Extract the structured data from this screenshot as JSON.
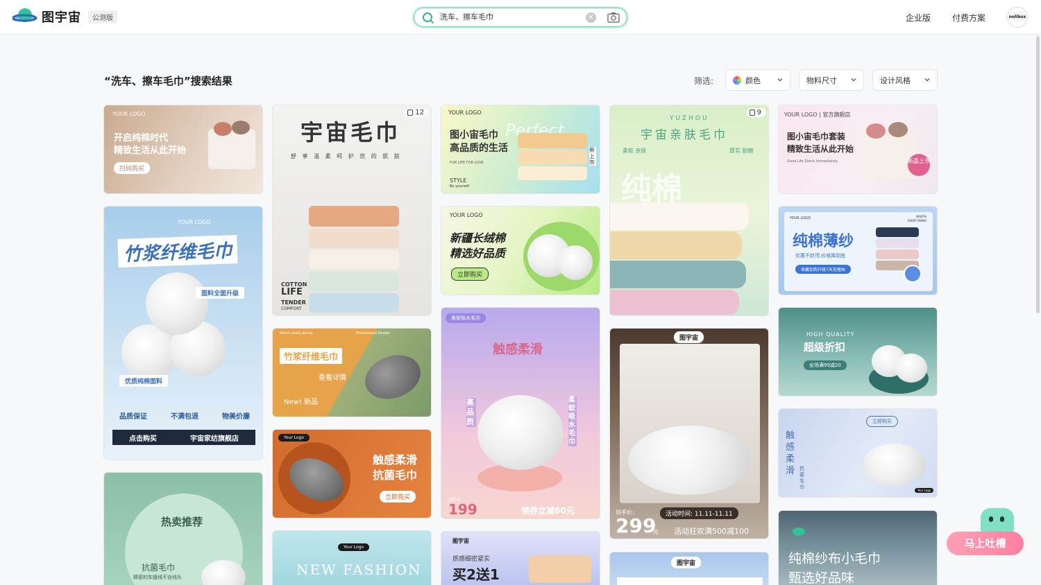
{
  "header": {
    "logo_text": "图宇宙",
    "beta_tag": "公测版",
    "search_value": "洗车、擦车毛巾",
    "clear_symbol": "✕",
    "nav_enterprise": "企业版",
    "nav_pricing": "付费方案",
    "avatar_text": "nolibox"
  },
  "results": {
    "title": "“洗车、擦车毛巾”搜索结果",
    "filter_label": "筛选:",
    "filters": [
      "颜色",
      "物料尺寸",
      "设计风格"
    ]
  },
  "cards": {
    "c1": {
      "line1": "开启纯棉时代",
      "line2": "精致生活从此开始",
      "button": "扫码购买",
      "logo": "YOUR LOGO"
    },
    "c2": {
      "title": "宇宙毛巾",
      "sub": "舒 享 温 柔 呵 护 您 的 肌 肤",
      "count": "12",
      "eng1": "COTTON",
      "eng2": "LIFE",
      "eng3": "TENDER",
      "eng4": "COMFORT"
    },
    "c3": {
      "line1": "图小宙毛巾",
      "line2": "高品质的生活",
      "bg_word": "Perfect",
      "small": "FOR LIFE FOR LOVE",
      "style": "STYLE",
      "style_sub": "Be yourself",
      "logo": "YOUR LOGO",
      "side": "新上市"
    },
    "c4": {
      "top": "YUZHOU",
      "title": "宇宙亲肤毛巾",
      "left": "柔软 亲肤",
      "right": "厚实 耐磨",
      "bg": "纯棉",
      "count": "9"
    },
    "c5": {
      "line1": "图小宙毛巾套装",
      "line2": "精致生活从此开始",
      "small": "Good Life Starts Immediately",
      "stamp": "新品上市",
      "logo": "YOUR LOGO | 官方旗舰店"
    },
    "c6": {
      "title": "竹浆纤维毛巾",
      "tag1": "面料全面升级",
      "tag2": "优质纯棉面料",
      "f1": "品质保证",
      "f2": "不满包退",
      "f3": "物美价廉",
      "buy": "点击购买",
      "store": "宇宙家纺旗舰店",
      "logo": "YOUR LOGO"
    },
    "c7": {
      "line1": "新疆长绒棉",
      "line2": "精选好品质",
      "button": "立即购买",
      "logo": "YOUR LOGO"
    },
    "c8": {
      "title": "纯棉薄纱",
      "sub": "优惠不封顶,价格降到底",
      "btn": "收藏加购升级7天无理由",
      "worth": "WORTH",
      "every": "EVERY PENNY",
      "logo": "YOUR LOGO"
    },
    "c9": {
      "title": "竹浆纤维毛巾",
      "link": "查看详情",
      "new": "New! 新品",
      "top_l": "Worth every penny",
      "top_r": "Professional Design"
    },
    "c10": {
      "tag": "柔软吸水毛巾",
      "title": "触感柔滑",
      "left": "高品质",
      "right": "柔软吸水毛巾",
      "price": "199",
      "price_label": "到手价",
      "coupon": "领券立减60元"
    },
    "c11": {
      "en": "HIGH QUALITY",
      "title": "超级折扣",
      "pill": "全场满99减20"
    },
    "c12": {
      "label": "到手价:",
      "price": "299",
      "unit": "元",
      "time": "活动时间: 11.11-11.11",
      "promo": "活动狂欢满500减100",
      "logo": "图宇宙"
    },
    "c13": {
      "line1": "触感柔滑",
      "line2": "抗菌毛巾",
      "button": "立即购买",
      "logo": "Your Logo"
    },
    "c14": {
      "left": "触感柔滑",
      "sub": "抗菌毛巾",
      "btn": "立即购买",
      "logo": "Your Logo"
    },
    "c15": {
      "title": "热卖推荐",
      "sub": "抗菌毛巾",
      "small": "精密的车缝线不含线头"
    },
    "c16": {
      "text": "NEW FASHION",
      "logo": "Your Logo"
    },
    "c17": {
      "small": "质感细密紧实",
      "title": "买2送1",
      "logo": "图宇宙"
    },
    "c18": {
      "logo": "图宇宙"
    },
    "c19": {
      "line1": "纯棉纱布小毛巾",
      "line2": "甄选好品味"
    }
  },
  "feedback": {
    "label": "马上吐槽"
  }
}
